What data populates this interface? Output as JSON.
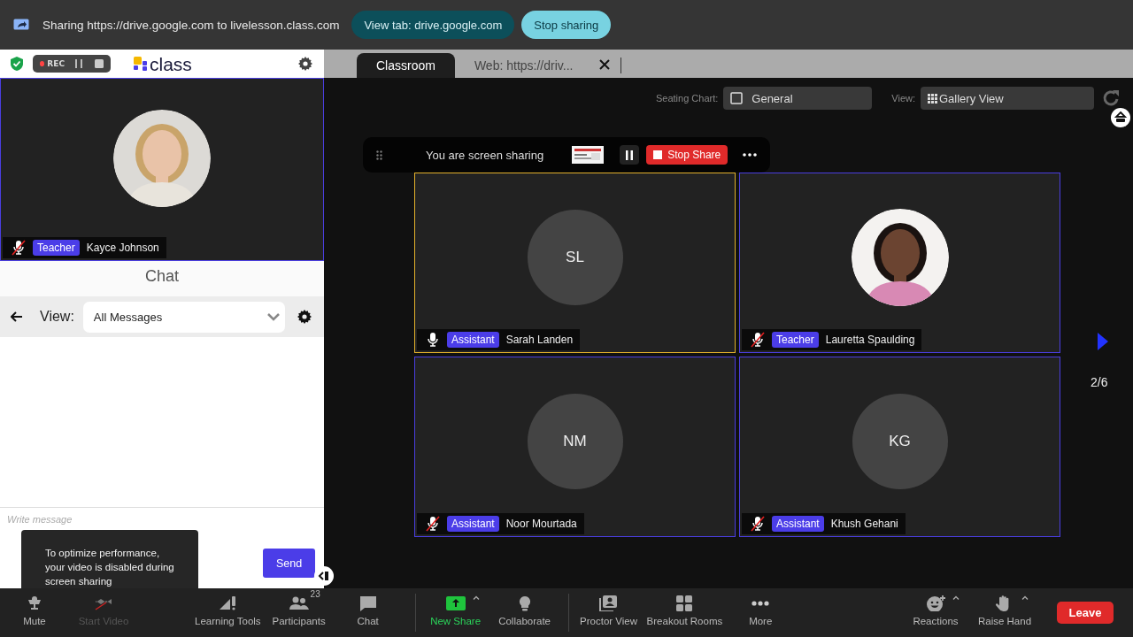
{
  "share_bar": {
    "message": "Sharing https://drive.google.com to livelesson.class.com",
    "buttons": [
      {
        "label": "View tab: drive.google.com",
        "kind": "secondary"
      },
      {
        "label": "Stop sharing",
        "kind": "primary"
      }
    ]
  },
  "app_header": {
    "recording": {
      "label": "REC"
    },
    "logo": "class"
  },
  "tabs": [
    {
      "label": "Classroom",
      "selected": true
    },
    {
      "label": "Web: https://driv...",
      "selected": false
    }
  ],
  "teacher_video": {
    "role": "Teacher",
    "name": "Kayce Johnson",
    "muted": true,
    "kind": "picture"
  },
  "chat": {
    "title": "Chat",
    "view_label": "View:",
    "filter": "All Messages",
    "placeholder": "Write message",
    "send": "Send"
  },
  "tooltip": "To optimize performance, your video is disabled during screen sharing",
  "seating_chart": {
    "label": "Seating Chart:",
    "value": "General"
  },
  "view": {
    "label": "View:",
    "value": "Gallery View"
  },
  "screen_share": {
    "message": "You are screen sharing",
    "stop": "Stop Share"
  },
  "participants": [
    {
      "initials": "SL",
      "role": "Assistant",
      "name": "Sarah Landen",
      "muted": false,
      "speaking": true,
      "kind": "initials"
    },
    {
      "role": "Teacher",
      "name": "Lauretta Spaulding",
      "muted": true,
      "speaking": false,
      "kind": "picture"
    },
    {
      "initials": "NM",
      "role": "Assistant",
      "name": "Noor Mourtada",
      "muted": true,
      "speaking": false,
      "kind": "initials"
    },
    {
      "initials": "KG",
      "role": "Assistant",
      "name": "Khush Gehani",
      "muted": true,
      "speaking": false,
      "kind": "initials"
    }
  ],
  "pager": "2/6",
  "toolbar": {
    "groups": [
      {
        "divider": false,
        "items": [
          {
            "label": "Mute",
            "disabled": false,
            "active": false,
            "has_menu": false
          },
          {
            "label": "Start Video",
            "disabled": true,
            "active": false,
            "has_menu": false
          }
        ]
      },
      {
        "divider": false,
        "items": [
          {
            "label": "Learning Tools",
            "disabled": false,
            "active": false,
            "has_menu": false
          },
          {
            "label": "Participants",
            "badge": "23",
            "disabled": false,
            "active": false,
            "has_menu": false
          },
          {
            "label": "Chat",
            "disabled": false,
            "active": false,
            "has_menu": false
          }
        ]
      },
      {
        "divider": true,
        "items": [
          {
            "label": "New Share",
            "disabled": false,
            "active": true,
            "has_menu": true
          },
          {
            "label": "Collaborate",
            "disabled": false,
            "active": false,
            "has_menu": false
          }
        ]
      },
      {
        "divider": true,
        "items": [
          {
            "label": "Proctor View",
            "disabled": false,
            "active": false,
            "has_menu": false
          },
          {
            "label": "Breakout Rooms",
            "disabled": false,
            "active": false,
            "has_menu": false
          },
          {
            "label": "More",
            "disabled": false,
            "active": false,
            "has_menu": false
          }
        ]
      }
    ],
    "right_items": [
      {
        "label": "Reactions",
        "disabled": false,
        "active": false,
        "has_menu": true
      },
      {
        "label": "Raise Hand",
        "disabled": false,
        "active": false,
        "has_menu": true
      }
    ],
    "leave": "Leave"
  }
}
